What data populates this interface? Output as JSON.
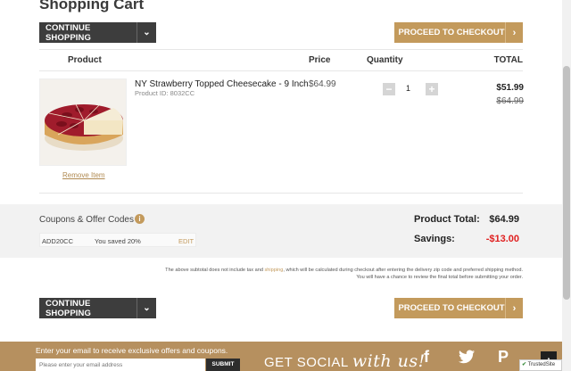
{
  "page": {
    "title": "Shopping Cart"
  },
  "buttons": {
    "continue_shopping": "CONTINUE SHOPPING",
    "proceed_checkout": "PROCEED TO CHECKOUT"
  },
  "table": {
    "headers": {
      "product": "Product",
      "price": "Price",
      "quantity": "Quantity",
      "total": "TOTAL"
    },
    "items": [
      {
        "name": "NY Strawberry Topped Cheesecake - 9 Inch",
        "product_id": "Product ID: 8032CC",
        "price": "$64.99",
        "quantity": "1",
        "total": "$51.99",
        "original_total": "$64.99",
        "remove_label": "Remove Item"
      }
    ]
  },
  "coupons": {
    "title": "Coupons & Offer Codes",
    "code": "ADD20CC",
    "saved": "You saved 20%",
    "edit_label": "EDIT"
  },
  "summary": {
    "product_total_label": "Product Total:",
    "product_total": "$64.99",
    "savings_label": "Savings:",
    "savings": "-$13.00",
    "savings_color": "#e02020"
  },
  "fineprint": {
    "line1_a": "The above subtotal does not include tax and",
    "line1_link": "shipping",
    "line1_b": ", which will be calculated during checkout after entering the delivery zip code and preferred shipping method.",
    "line2": "You will have a chance to review the final total before submitting your order."
  },
  "footer": {
    "signup_text": "Enter your email to receive exclusive offers and coupons.",
    "email_placeholder": "Please enter your email address",
    "submit_label": "SUBMIT",
    "social_get": "GET SOCIAL",
    "social_script": "with us!",
    "social_icons": [
      "facebook-icon",
      "twitter-icon",
      "pinterest-icon"
    ],
    "trusted_label": "TrustedSite"
  },
  "colors": {
    "accent_gold": "#c39a5c",
    "dark_button": "#3d3d3d",
    "footer_bg": "#b6905f"
  }
}
